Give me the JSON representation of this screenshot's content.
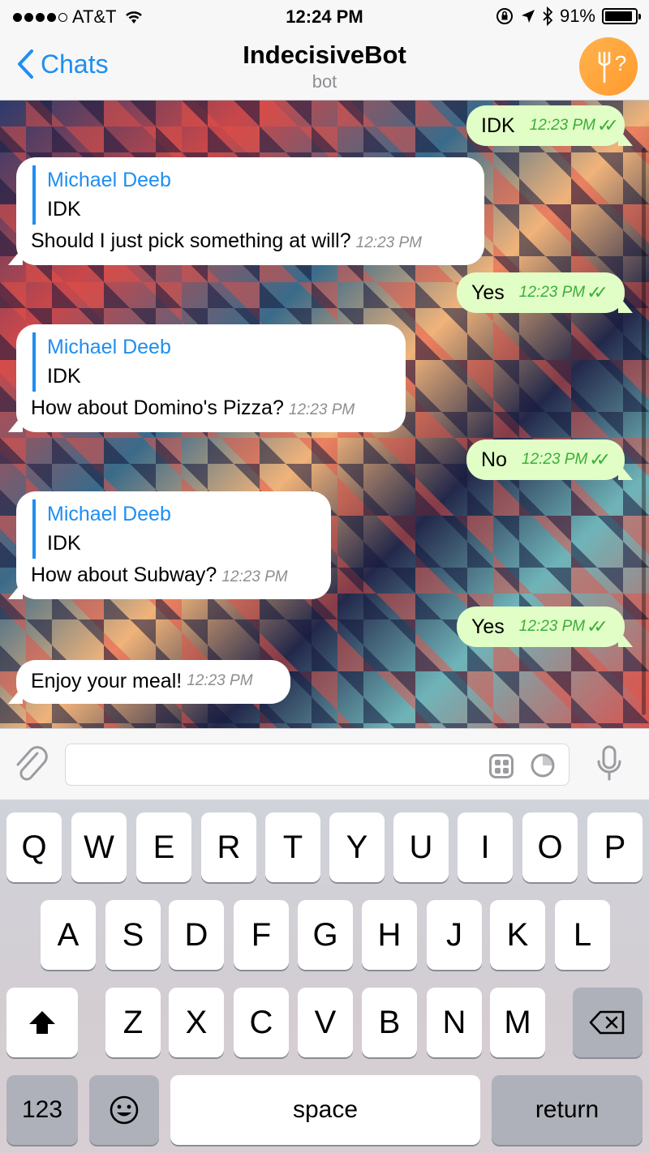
{
  "status_bar": {
    "carrier": "AT&T",
    "time": "12:24 PM",
    "battery": "91%",
    "battery_level": 0.91
  },
  "nav": {
    "back_label": "Chats",
    "title": "IndecisiveBot",
    "subtitle": "bot",
    "avatar_glyph": "?"
  },
  "messages": [
    {
      "dir": "out",
      "text": "IDK",
      "time": "12:23 PM"
    },
    {
      "dir": "in",
      "reply_name": "Michael Deeb",
      "reply_text": "IDK",
      "text": "Should I just pick something at will?",
      "time": "12:23 PM"
    },
    {
      "dir": "out",
      "text": "Yes",
      "time": "12:23 PM"
    },
    {
      "dir": "in",
      "reply_name": "Michael Deeb",
      "reply_text": "IDK",
      "text": "How about Domino's Pizza?",
      "time": "12:23 PM"
    },
    {
      "dir": "out",
      "text": "No",
      "time": "12:23 PM"
    },
    {
      "dir": "in",
      "reply_name": "Michael Deeb",
      "reply_text": "IDK",
      "text": "How about Subway?",
      "time": "12:23 PM"
    },
    {
      "dir": "out",
      "text": "Yes",
      "time": "12:23 PM"
    },
    {
      "dir": "in",
      "text": "Enjoy your meal!",
      "time": "12:23 PM"
    }
  ],
  "input": {
    "placeholder": ""
  },
  "keyboard": {
    "row1": [
      "Q",
      "W",
      "E",
      "R",
      "T",
      "Y",
      "U",
      "I",
      "O",
      "P"
    ],
    "row2": [
      "A",
      "S",
      "D",
      "F",
      "G",
      "H",
      "J",
      "K",
      "L"
    ],
    "row3": [
      "Z",
      "X",
      "C",
      "V",
      "B",
      "N",
      "M"
    ],
    "numbers_label": "123",
    "space_label": "space",
    "return_label": "return"
  },
  "colors": {
    "accent": "#1f8ef1",
    "outgoing_bubble": "#e1fec6",
    "read_ticks": "#3cae3a",
    "bot_avatar": "#ffa63a"
  },
  "icons": [
    "signal-dots-icon",
    "wifi-icon",
    "orientation-lock-icon",
    "location-icon",
    "bluetooth-icon",
    "battery-icon",
    "chevron-left-icon",
    "fork-icon",
    "paperclip-icon",
    "sticker-icon",
    "clock-icon",
    "microphone-icon",
    "shift-icon",
    "backspace-icon",
    "emoji-icon"
  ]
}
